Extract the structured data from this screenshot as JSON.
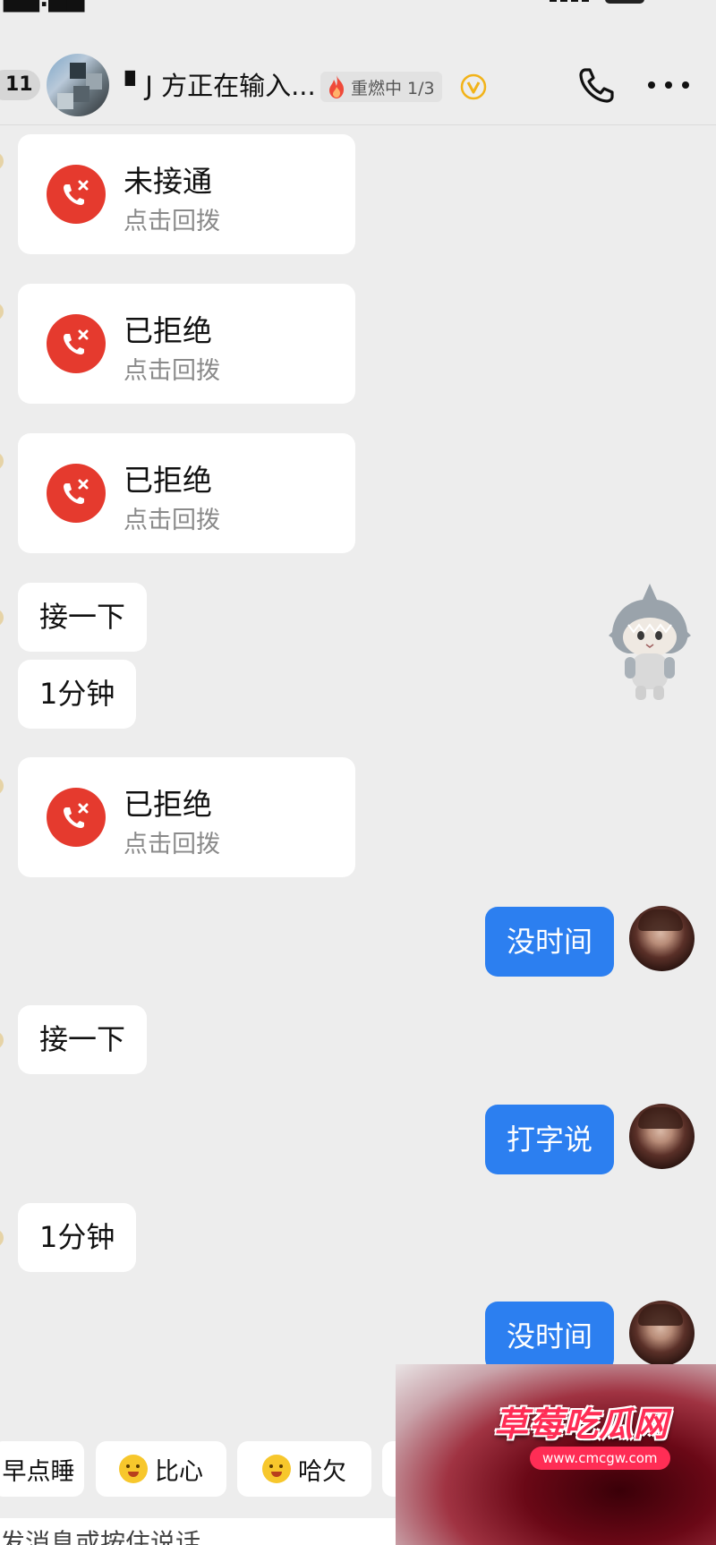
{
  "header": {
    "unread_count": "11",
    "title": "▘J 方正在输入...",
    "flame_label": "重燃中 1/3"
  },
  "messages": {
    "call_1": {
      "title": "未接通",
      "subtitle": "点击回拨"
    },
    "call_2": {
      "title": "已拒绝",
      "subtitle": "点击回拨"
    },
    "call_3": {
      "title": "已拒绝",
      "subtitle": "点击回拨"
    },
    "text_1": "接一下",
    "text_2": "1分钟",
    "call_4": {
      "title": "已拒绝",
      "subtitle": "点击回拨"
    },
    "reply_1": "没时间",
    "text_3": "接一下",
    "reply_2": "打字说",
    "text_4": "1分钟",
    "reply_3": "没时间"
  },
  "quick_replies": [
    "早点睡",
    "比心",
    "哈欠"
  ],
  "input_placeholder": "发消息或按住说话",
  "watermark": {
    "logo": "草莓吃瓜网",
    "url": "www.cmcgw.com"
  },
  "colors": {
    "background": "#ededed",
    "outgoing_bubble": "#2c7ff0",
    "call_icon": "#e53a2e",
    "vip_badge": "#f2b319"
  }
}
